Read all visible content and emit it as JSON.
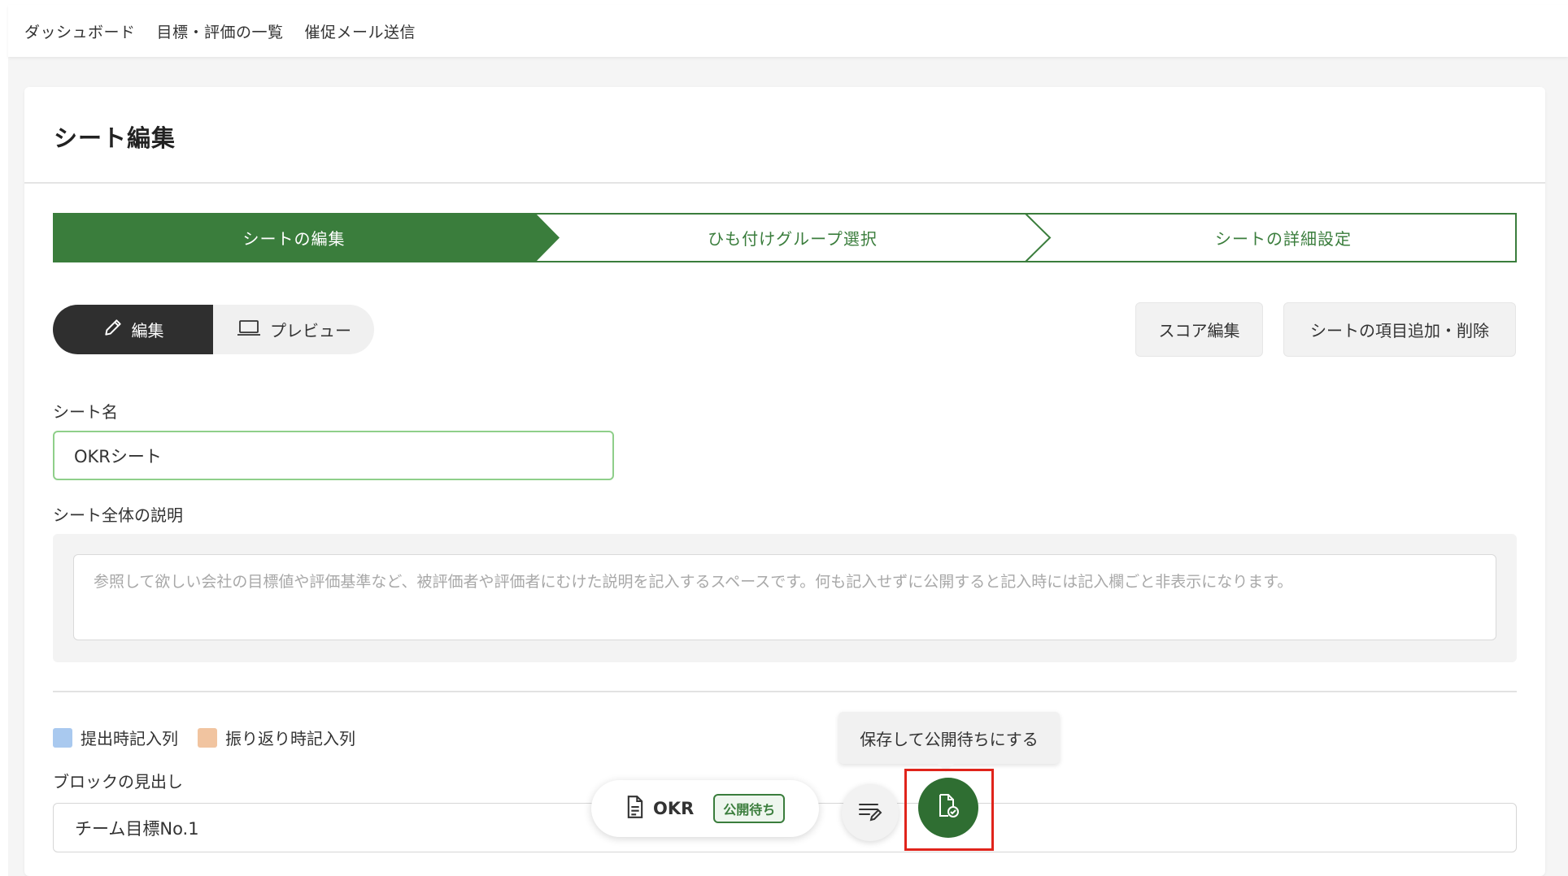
{
  "nav": {
    "items": [
      "ダッシュボード",
      "目標・評価の一覧",
      "催促メール送信"
    ]
  },
  "page": {
    "title": "シート編集"
  },
  "stepper": {
    "steps": [
      "シートの編集",
      "ひも付けグループ選択",
      "シートの詳細設定"
    ],
    "active_color": "#3a7d3c"
  },
  "mode_toggle": {
    "edit_label": "編集",
    "preview_label": "プレビュー"
  },
  "actions": {
    "score_edit": "スコア編集",
    "add_remove_items": "シートの項目追加・削除"
  },
  "form": {
    "sheet_name_label": "シート名",
    "sheet_name_value": "OKRシート",
    "description_label": "シート全体の説明",
    "description_placeholder": "参照して欲しい会社の目標値や評価基準など、被評価者や評価者にむけた説明を記入するスペースです。何も記入せずに公開すると記入時には記入欄ごと非表示になります。"
  },
  "legend": {
    "submit_label": "提出時記入列",
    "submit_color": "#a9c9ef",
    "review_label": "振り返り時記入列",
    "review_color": "#f1c4a0"
  },
  "block": {
    "heading_label": "ブロックの見出し",
    "heading_value": "チーム目標No.1"
  },
  "toolbar": {
    "sheet_title": "OKR",
    "status_badge": "公開待ち",
    "tooltip": "保存して公開待ちにする"
  }
}
